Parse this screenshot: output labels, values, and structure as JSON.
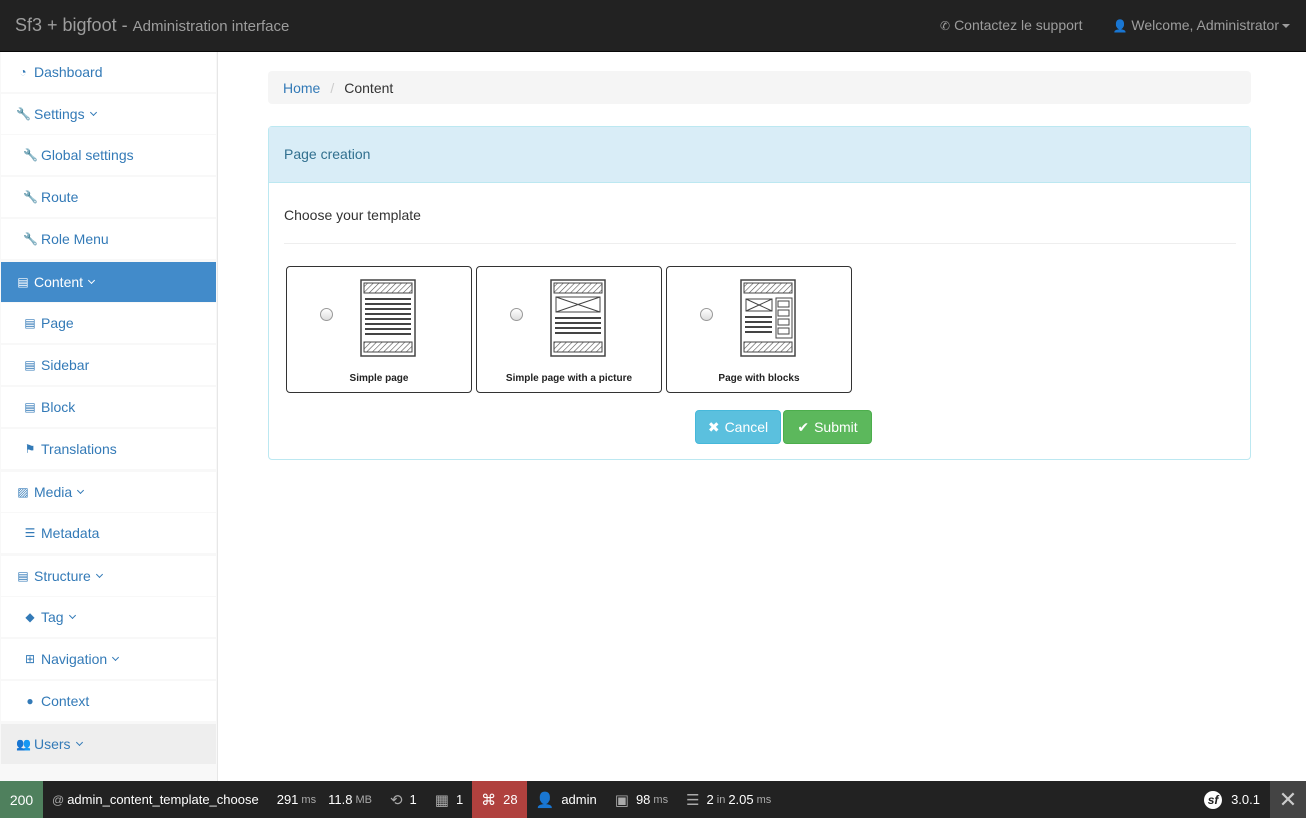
{
  "navbar": {
    "brand": "Sf3 + bigfoot -",
    "brand_sub": "Administration interface",
    "support": "Contactez le support",
    "welcome": "Welcome, Administrator"
  },
  "sidebar": {
    "items": [
      {
        "label": "Dashboard"
      },
      {
        "label": "Settings"
      },
      {
        "label": "Global settings"
      },
      {
        "label": "Route"
      },
      {
        "label": "Role Menu"
      },
      {
        "label": "Content"
      },
      {
        "label": "Page"
      },
      {
        "label": "Sidebar"
      },
      {
        "label": "Block"
      },
      {
        "label": "Translations"
      },
      {
        "label": "Media"
      },
      {
        "label": "Metadata"
      },
      {
        "label": "Structure"
      },
      {
        "label": "Tag"
      },
      {
        "label": "Navigation"
      },
      {
        "label": "Context"
      },
      {
        "label": "Users"
      }
    ]
  },
  "breadcrumb": {
    "home": "Home",
    "current": "Content"
  },
  "panel": {
    "heading": "Page creation",
    "choose": "Choose your template",
    "templates": [
      {
        "label": "Simple page"
      },
      {
        "label": "Simple page with a picture"
      },
      {
        "label": "Page with blocks"
      }
    ],
    "cancel": "Cancel",
    "submit": "Submit"
  },
  "toolbar": {
    "status": "200",
    "route": "admin_content_template_choose",
    "time": "291",
    "time_unit": "ms",
    "memory": "11.8",
    "memory_unit": "MB",
    "forms": "1",
    "logs": "1",
    "translations": "28",
    "user": "admin",
    "twig": "98",
    "twig_unit": "ms",
    "db_queries": "2",
    "db_in": "in",
    "db_time": "2.05",
    "db_unit": "ms",
    "version": "3.0.1"
  },
  "colors": {
    "active_item": "#428bca",
    "link": "#337ab7",
    "panel_heading_bg": "#d9edf7",
    "cancel_btn": "#5bc0de",
    "submit_btn": "#5cb85c",
    "status_ok": "#4f805d",
    "toolbar_alert": "#b0413e"
  }
}
